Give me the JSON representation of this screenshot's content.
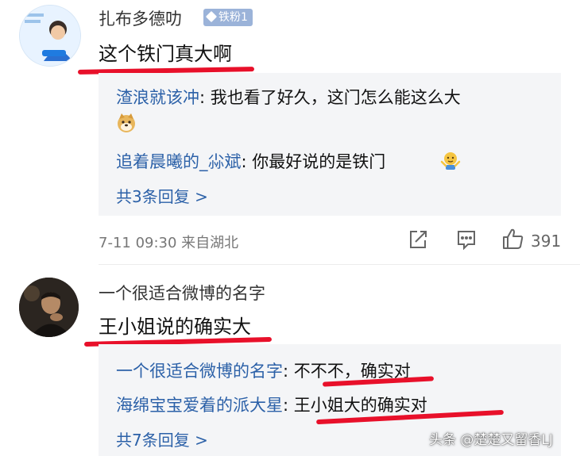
{
  "comments": [
    {
      "username": "扎布多德叻",
      "badge": "铁粉1",
      "text": "这个铁门真大啊",
      "replies": [
        {
          "name": "渣浪就该冲",
          "text": ": 我也看了好久，这门怎么能这么大"
        },
        {
          "name": "追着晨曦的_尛斌",
          "text": ": 你最好说的是铁门"
        }
      ],
      "more": "共3条回复 >",
      "meta": "7-11 09:30  来自湖北",
      "likes": "391"
    },
    {
      "username": "一个很适合微博的名字",
      "text": "王小姐说的确实大",
      "replies": [
        {
          "name": "一个很适合微博的名字",
          "text": ": 不不不，确实对"
        },
        {
          "name": "海绵宝宝爱着的派大星",
          "text": ": 王小姐大的确实对"
        }
      ],
      "more": "共7条回复 >"
    }
  ],
  "watermark": "头条 @楚楚又留香LJ",
  "colors": {
    "link": "#2c61a8",
    "underline": "#e8102a",
    "badge": "#9bb3d9",
    "reply_bg": "#f4f5f7"
  },
  "icons": [
    "share-icon",
    "comment-icon",
    "thumbs-up-icon",
    "doge-emoji-icon",
    "shrug-emoji-icon"
  ]
}
